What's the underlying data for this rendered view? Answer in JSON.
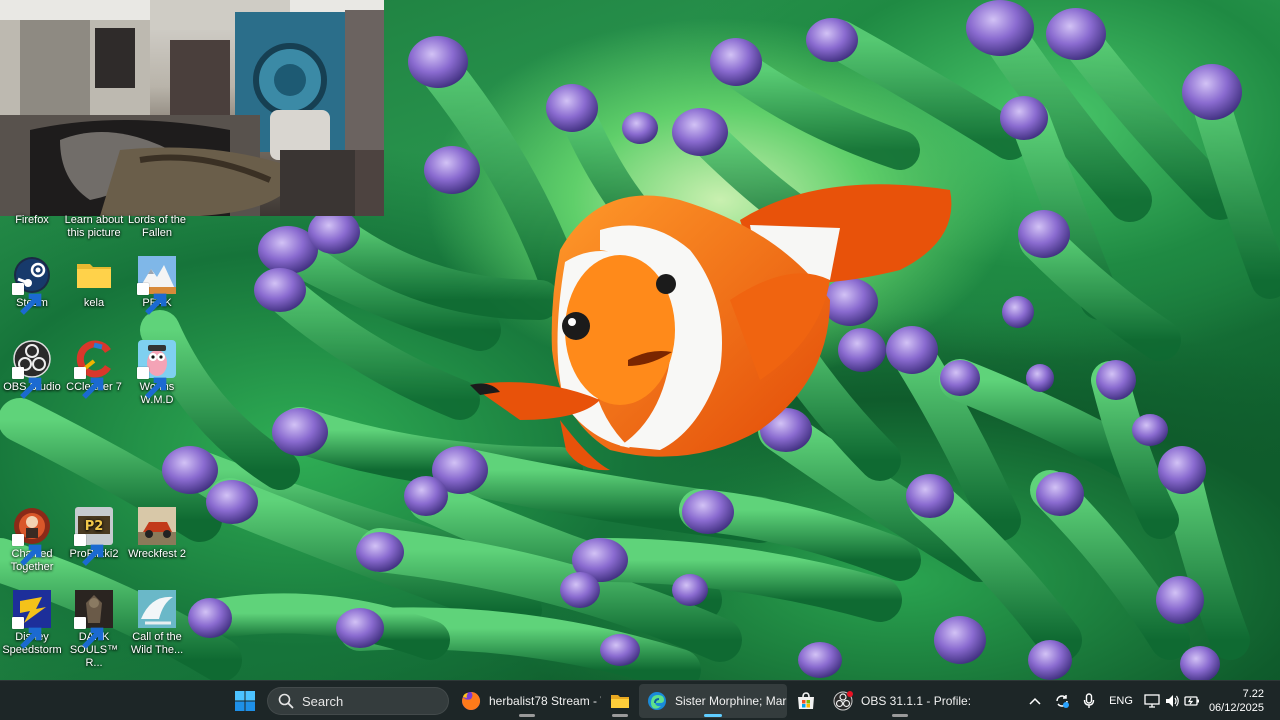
{
  "desktop": {
    "row0": [
      {
        "name": "firefox",
        "label": "Firefox"
      },
      {
        "name": "learn-about-picture",
        "label": "Learn about this picture"
      },
      {
        "name": "lords-of-the-fallen",
        "label": "Lords of the Fallen"
      }
    ],
    "icons": [
      {
        "label": "Steam"
      },
      {
        "label": "kela"
      },
      {
        "label": "PEAK"
      },
      {
        "label": "OBS Studio"
      },
      {
        "label": "CCleaner 7"
      },
      {
        "label": "Worms W.M.D"
      },
      {
        "label": "Chained Together"
      },
      {
        "label": "ProPilkki2"
      },
      {
        "label": "Wreckfest 2"
      },
      {
        "label": "Disney Speedstorm"
      },
      {
        "label": "DARK SOULS™ R..."
      },
      {
        "label": "Call of the Wild The..."
      }
    ]
  },
  "taskbar": {
    "search_label": "Search",
    "apps": [
      {
        "title": "herbalist78 Stream - Wa"
      },
      {
        "title": ""
      },
      {
        "title": "Sister Morphine; Marian"
      },
      {
        "title": ""
      },
      {
        "title": "OBS 31.1.1 - Profile: Unti"
      }
    ],
    "tray": {
      "language": "ENG"
    },
    "clock": {
      "time": "7.22",
      "date": "06/12/2025"
    }
  },
  "colors": {
    "taskbar_bg": "#202428",
    "active_indicator": "#60cdff",
    "accent_windows": "#0a7fd8"
  }
}
